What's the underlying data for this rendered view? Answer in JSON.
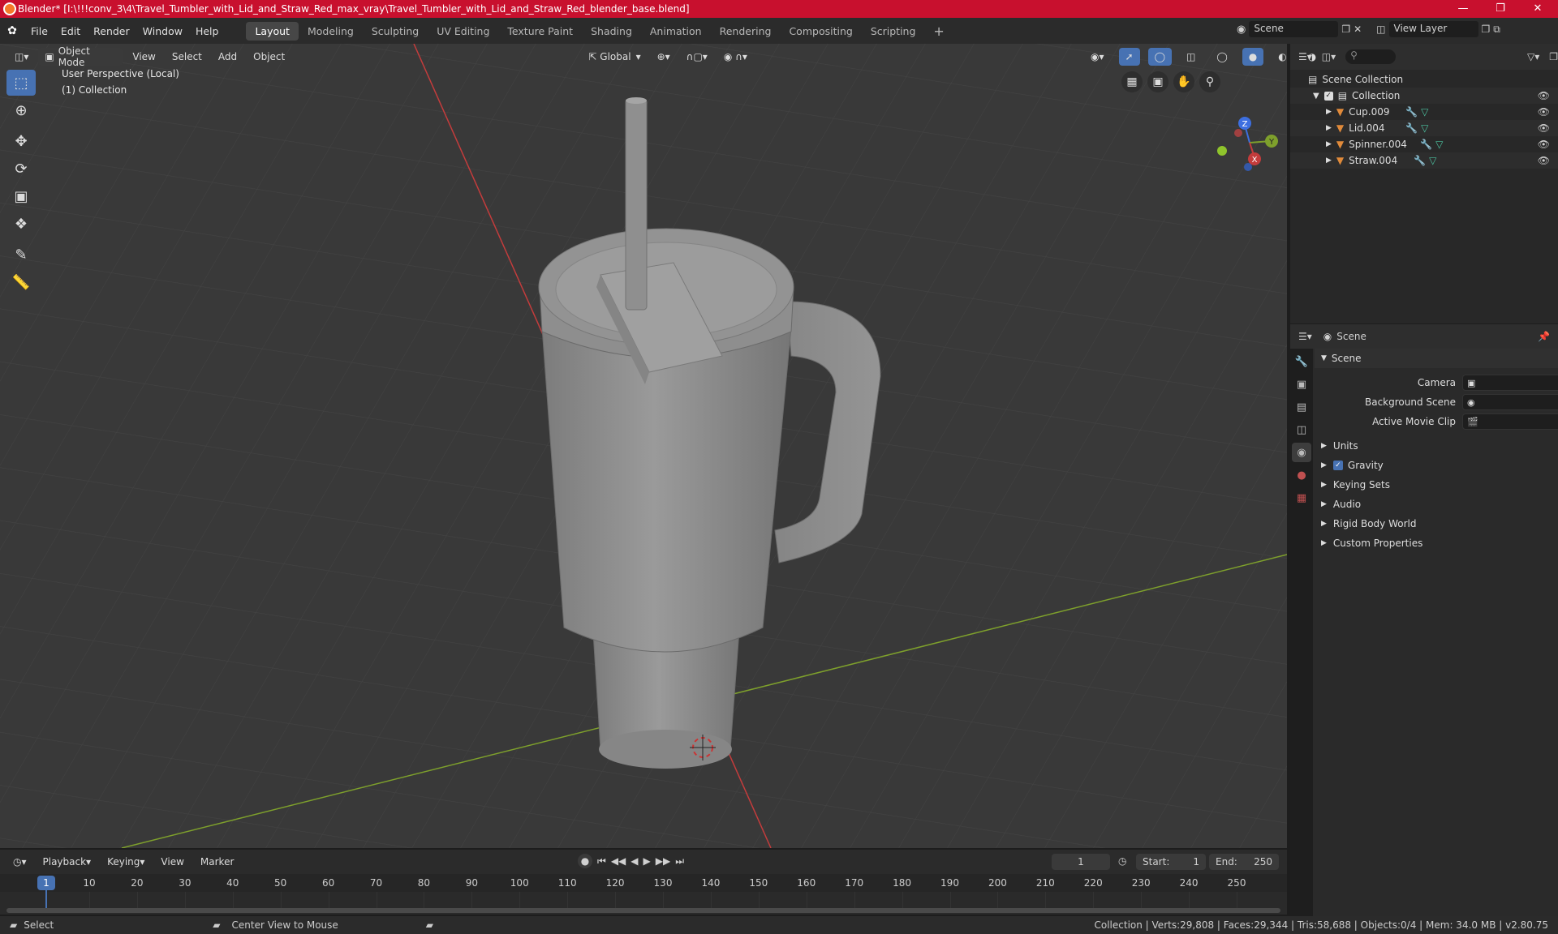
{
  "window": {
    "title": "Blender* [I:\\!!!conv_3\\4\\Travel_Tumbler_with_Lid_and_Straw_Red_max_vray\\Travel_Tumbler_with_Lid_and_Straw_Red_blender_base.blend]",
    "minimize_icon": "minimize-icon",
    "maximize_icon": "maximize-icon",
    "close_icon": "close-icon",
    "title_bar_color": "#c8102e"
  },
  "menubar": {
    "menus": [
      "File",
      "Edit",
      "Render",
      "Window",
      "Help"
    ],
    "workspaces": [
      "Layout",
      "Modeling",
      "Sculpting",
      "UV Editing",
      "Texture Paint",
      "Shading",
      "Animation",
      "Rendering",
      "Compositing",
      "Scripting"
    ],
    "active_workspace": "Layout",
    "add_workspace": "+",
    "scene_label": "Scene",
    "view_layer_label": "View Layer"
  },
  "viewport_header": {
    "mode": "Object Mode",
    "menus": [
      "View",
      "Select",
      "Add",
      "Object"
    ],
    "transform_orientation": "Global"
  },
  "viewport": {
    "perspective_label": "User Perspective (Local)",
    "collection_label": "(1) Collection",
    "gizmo_axes": [
      "Z",
      "Y",
      "X"
    ],
    "background": "#393939",
    "x_axis_color": "#c43c3c",
    "y_axis_color": "#7ea02c",
    "object_color": "#8a8a8a"
  },
  "tools": [
    "select-box-icon",
    "cursor-icon",
    "move-icon",
    "rotate-icon",
    "scale-icon",
    "transform-icon",
    "annotate-icon",
    "measure-icon"
  ],
  "outliner": {
    "root": "Scene Collection",
    "collection": "Collection",
    "objects": [
      "Cup.009",
      "Lid.004",
      "Spinner.004",
      "Straw.004"
    ]
  },
  "properties": {
    "context": "Scene",
    "section": "Scene",
    "fields": [
      {
        "label": "Camera"
      },
      {
        "label": "Background Scene"
      },
      {
        "label": "Active Movie Clip"
      }
    ],
    "panels": [
      "Units",
      "Gravity",
      "Keying Sets",
      "Audio",
      "Rigid Body World",
      "Custom Properties"
    ],
    "gravity_checked": true
  },
  "timeline": {
    "menus": [
      "Playback",
      "Keying",
      "View",
      "Marker"
    ],
    "current_frame": "1",
    "start_label": "Start:",
    "start": "1",
    "end_label": "End:",
    "end": "250",
    "frame_ticks": [
      "1",
      "10",
      "20",
      "30",
      "40",
      "50",
      "60",
      "70",
      "80",
      "90",
      "100",
      "110",
      "120",
      "130",
      "140",
      "150",
      "160",
      "170",
      "180",
      "190",
      "200",
      "210",
      "220",
      "230",
      "240",
      "250"
    ]
  },
  "statusbar": {
    "left": "Select",
    "middle": "Center View to Mouse",
    "stats": "Collection | Verts:29,808 | Faces:29,344 | Tris:58,688 | Objects:0/4 | Mem: 34.0 MB | v2.80.75"
  }
}
